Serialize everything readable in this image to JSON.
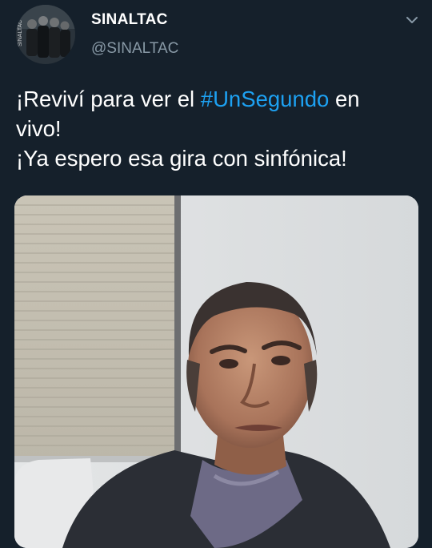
{
  "author": {
    "display_name": "SINALTAC",
    "handle": "@SINALTAC",
    "avatar_text": "SINALTAC"
  },
  "menu": {
    "icon": "chevron-down-icon"
  },
  "tweet": {
    "line1_before": "¡Reviví para ver el ",
    "hashtag": "#UnSegundo",
    "line1_after": " en",
    "line2": "vivo!",
    "line3": "¡Ya espero esa gira con sinfónica!"
  },
  "media": {
    "type": "video-frame"
  },
  "colors": {
    "background": "#15202b",
    "text": "#ffffff",
    "secondary_text": "#8899a6",
    "link": "#1da1f2"
  }
}
